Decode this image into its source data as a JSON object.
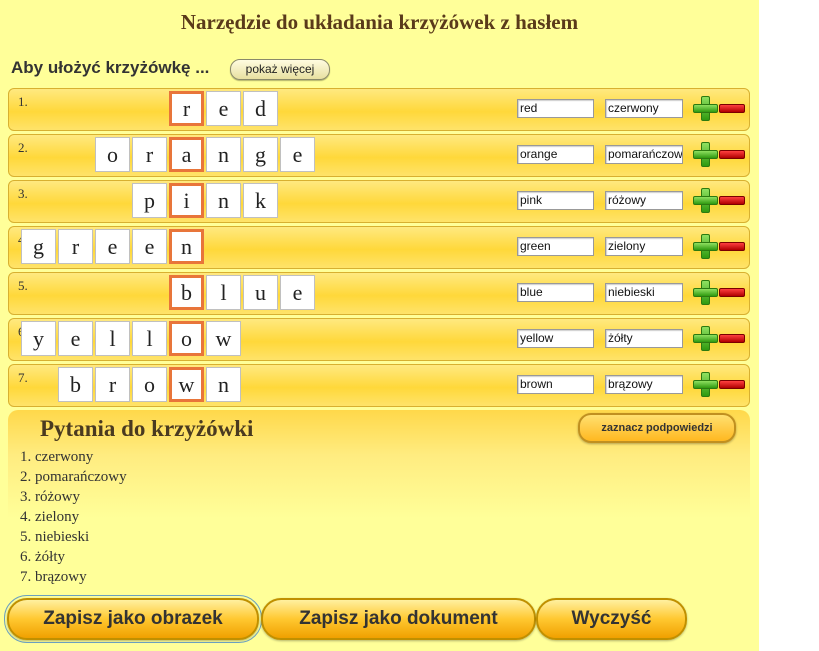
{
  "title": "Narzędzie do układania krzyżówek z hasłem",
  "intro": {
    "label": "Aby ułożyć krzyżówkę ...",
    "more_button": "pokaż więcej"
  },
  "rows": [
    {
      "number": "1.",
      "word": "red",
      "translation": "czerwony",
      "letters": [
        "r",
        "e",
        "d"
      ]
    },
    {
      "number": "2.",
      "word": "orange",
      "translation": "pomarańczowy",
      "letters": [
        "o",
        "r",
        "a",
        "n",
        "g",
        "e"
      ]
    },
    {
      "number": "3.",
      "word": "pink",
      "translation": "różowy",
      "letters": [
        "p",
        "i",
        "n",
        "k"
      ]
    },
    {
      "number": "4.",
      "word": "green",
      "translation": "zielony",
      "letters": [
        "g",
        "r",
        "e",
        "e",
        "n"
      ]
    },
    {
      "number": "5.",
      "word": "blue",
      "translation": "niebieski",
      "letters": [
        "b",
        "l",
        "u",
        "e"
      ]
    },
    {
      "number": "6.",
      "word": "yellow",
      "translation": "żółty",
      "letters": [
        "y",
        "e",
        "l",
        "l",
        "o",
        "w"
      ]
    },
    {
      "number": "7.",
      "word": "brown",
      "translation": "brązowy",
      "letters": [
        "b",
        "r",
        "o",
        "w",
        "n"
      ]
    }
  ],
  "questions": {
    "title": "Pytania do krzyżówki",
    "hint_button": "zaznacz podpowiedzi",
    "items": [
      "1. czerwony",
      "2. pomarańczowy",
      "3. różowy",
      "4. zielony",
      "5. niebieski",
      "6. żółty",
      "7. brązowy"
    ]
  },
  "actions": {
    "save_image": "Zapisz jako obrazek",
    "save_document": "Zapisz jako dokument",
    "clear": "Wyczyść"
  },
  "icons": {
    "add": "plus-icon",
    "remove": "minus-icon"
  },
  "colors": {
    "background": "#ffff99",
    "key_border": "#e8753a",
    "plus": "#3aa010",
    "minus": "#cc0000"
  }
}
